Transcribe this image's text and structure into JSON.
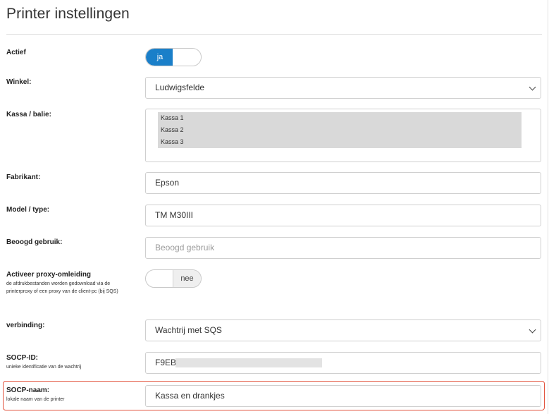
{
  "page": {
    "title": "Printer instellingen"
  },
  "actief": {
    "label": "Actief",
    "toggle_on": "ja"
  },
  "winkel": {
    "label": "Winkel:",
    "value": "Ludwigsfelde"
  },
  "kassa": {
    "label": "Kassa / balie:",
    "options": [
      "Kassa 1",
      "Kassa 2",
      "Kassa 3"
    ]
  },
  "fabrikant": {
    "label": "Fabrikant:",
    "value": "Epson"
  },
  "model": {
    "label": "Model / type:",
    "value": "TM M30III"
  },
  "gebruik": {
    "label": "Beoogd gebruik:",
    "placeholder": "Beoogd gebruik"
  },
  "proxy": {
    "label": "Activeer proxy-omleiding",
    "hint": "de afdrukbestanden worden gedownload via de printerproxy of een proxy van de client-pc (bij SQS)",
    "toggle_off": "nee"
  },
  "verbinding": {
    "label": "verbinding:",
    "value": "Wachtrij met SQS"
  },
  "socp_id": {
    "label": "SOCP-ID:",
    "hint": "unieke identificatie van de wachtrij",
    "value": "F9EB"
  },
  "socp_naam": {
    "label": "SOCP-naam:",
    "hint": "lokale naam van de printer",
    "value": "Kassa en drankjes"
  },
  "colors": {
    "accent": "#1a7fc9",
    "highlight": "#e2533d"
  }
}
